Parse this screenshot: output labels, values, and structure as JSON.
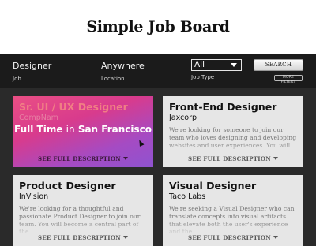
{
  "site": {
    "title": "Simple Job Board"
  },
  "search": {
    "job_value": "Designer",
    "job_label": "Job",
    "location_value": "Anywhere",
    "location_label": "Location",
    "type_value": "All",
    "type_label": "Job Type",
    "search_button": "SEARCH",
    "more_filters": "MORE FILTERS"
  },
  "jobs": [
    {
      "title": "Sr. UI / UX Designer",
      "company": "CompNam",
      "type": "Full Time",
      "in_word": "in",
      "location": "San Francisco",
      "more": "SEE FULL DESCRIPTION"
    },
    {
      "title": "Front-End Designer",
      "company": "Jaxcorp",
      "description": "We're looking for someone to join our team who loves designing and developing websites and user experiences. You will",
      "more": "SEE FULL DESCRIPTION"
    },
    {
      "title": "Product Designer",
      "company": "InVision",
      "description": "We're looking for a thoughtful and passionate Product Designer to join our team. You will become a central part of the",
      "more": "SEE FULL DESCRIPTION"
    },
    {
      "title": "Visual Designer",
      "company": "Taco Labs",
      "description": "We're seeking a Visual Designer who can translate concepts into visual artifacts that elevate both the user's experience and the",
      "more": "SEE FULL DESCRIPTION"
    }
  ]
}
